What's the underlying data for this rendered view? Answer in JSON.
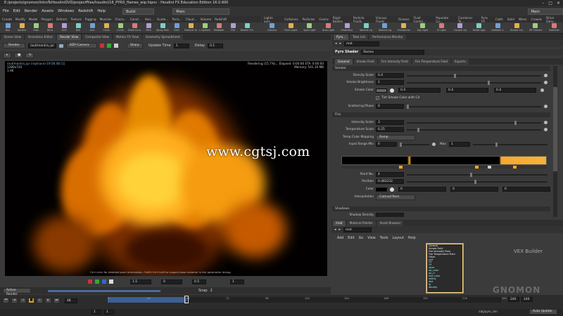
{
  "window": {
    "title": "E:/projects/gnomon/IntroToHoudiniDVD/projectFiles/houdini/16_PYRO_flames_wip.hipnc - Houdini FX Education Edition 16.0.600",
    "controls": [
      "–",
      "□",
      "✕"
    ]
  },
  "menu": {
    "items": [
      "File",
      "Edit",
      "Render",
      "Assets",
      "Windows",
      "Redshift",
      "Help"
    ],
    "desk_left": "Build",
    "desk_mid": "Main",
    "desk_right": "Main"
  },
  "shelf_tabs_left": [
    "Create",
    "Modify",
    "Model",
    "Polygon",
    "Deform",
    "Texture",
    "Rigging",
    "Muscles",
    "Chara...",
    "Const...",
    "Hair...",
    "Guide...",
    "Terra...",
    "Cloud...",
    "Volume",
    "Redshift"
  ],
  "shelf_tabs_right": [
    "Lights and...",
    "Collisions",
    "Particles",
    "Grains",
    "Rigid Bodies",
    "Particle Fluids",
    "Viscous Fluids",
    "Oceans",
    "Fluid Contai...",
    "Populate Co...",
    "Container To...",
    "Pyro FX",
    "Cloth",
    "Solid",
    "Wires",
    "Crowds",
    "Drive Simu..."
  ],
  "shelf_tools_left": [
    "Box",
    "Sphere",
    "Tube",
    "Torus",
    "Grid",
    "Null",
    "Line",
    "Circle",
    "Curve",
    "Draw Curve",
    "Path",
    "Spray Paint",
    "Font",
    "Platonic Solids",
    "L-System",
    "Metaball",
    "File",
    "Bleach Frame"
  ],
  "shelf_tools_right": [
    "Camera",
    "Point Light",
    "Spot Light",
    "Area Light",
    "Geometry Light",
    "Volume Light",
    "Distant Light",
    "Environment Light",
    "Sky Light",
    "GI Light",
    "Caustic Light",
    "Portal Light",
    "Ambient Light",
    "Stereo Camera",
    "VR Camera",
    "Switcher"
  ],
  "left_pane": {
    "tabs": [
      "Scene View",
      "Animation Editor",
      "Render View",
      "Composite View",
      "Motion FX View",
      "Geometry Spreadsheet"
    ],
    "render_button": "Render",
    "rop_path": "/out/mantra_ipr",
    "camera": "KDP Camera",
    "update_time_label": "Update Time",
    "update_time": "1",
    "delay_label": "Delay",
    "delay": "0.1",
    "snapshot_label": "Sharp",
    "rendering_status": "Rendering (15.7%)...  Elapsed: 0:00:06   ETA: 0:00:00",
    "memory": "Memory:     541.16 MB",
    "image_info_1": "/out/mantra_ipr (raytrace)-19:56:48 [1]",
    "image_info_2": "1280x720",
    "image_info_3": "1:46",
    "hint": "Ctrl+click for detailed pixel information. Shift+Ctrl+Left to inspect base material in the parameter dialog.",
    "bottom_fields": [
      "1.5",
      "0",
      "0.5",
      "1"
    ],
    "active_render": "Active Render",
    "snap_label": "Snap",
    "snap_value": "2"
  },
  "watermark": "www.cgtsj.com",
  "right_pane": {
    "tabs": [
      "Pyro...",
      "Take List",
      "Performance Monitor"
    ],
    "path": "mat",
    "shader_type": "Pyro Shader",
    "shader_name": "flames",
    "param_tabs": [
      "General",
      "Smoke Field",
      "Fire Intensity Field",
      "Fire Temperature Field",
      "Exports"
    ],
    "section_smoke": "Smoke",
    "density_scale_label": "Density Scale",
    "density_scale": "0.4",
    "smoke_brightness_label": "Smoke Brightness",
    "smoke_brightness": "1",
    "smoke_color_label": "Smoke Color",
    "smoke_color": [
      "0.4",
      "0.4",
      "0.4"
    ],
    "tint_label": "Tint Smoke Color with Cd",
    "scattering_phase_label": "Scattering Phase",
    "scattering_phase": "0",
    "section_fire": "Fire",
    "intensity_scale_label": "Intensity Scale",
    "intensity_scale": "3",
    "temperature_scale_label": "Temperature Scale",
    "temperature_scale": "0.25",
    "temp_mapping_label": "Temp Color Mapping",
    "temp_mapping": "Ramp",
    "input_range_label": "Input Range Min",
    "input_range_min": "0",
    "max_label": "Max",
    "input_range_max": "1",
    "point_no_label": "Point No.",
    "point_no": "4",
    "position_label": "Position",
    "position": "0.483232",
    "color_label": "Color",
    "color_values": [
      "0",
      "0",
      "0"
    ],
    "interpolation_label": "Interpolation",
    "interpolation": "Catmull-Rom",
    "section_shadows": "Shadows",
    "shadow_density_label": "Shadow Density"
  },
  "network_pane": {
    "tabs": [
      "/mat",
      "Material Palette",
      "Asset Browser"
    ],
    "path": "mat",
    "menu": [
      "Add",
      "Edit",
      "Go",
      "View",
      "Tools",
      "Layout",
      "Help"
    ],
    "builder_label": "VEX Builder",
    "node_rows": [
      "General",
      "Smoke Field",
      "Fire Intensity Field",
      "Fire Temperature Field",
      "Other",
      "surf",
      "Ce",
      "Of",
      "layer",
      "op_color",
      "op_ci",
      "inst_color",
      "intens",
      "dist",
      "lg",
      "density"
    ]
  },
  "timeline": {
    "current_frame": "48",
    "start": "1",
    "end": "240",
    "ticks": [
      "1",
      "24",
      "48",
      "72",
      "96",
      "120",
      "144",
      "168",
      "192",
      "216",
      "240"
    ],
    "auto_update": "Auto Update",
    "file_path": "/obj/pyro_sim"
  },
  "branding": "GNOMON",
  "colors": {
    "accent_blue": "#3d5f92",
    "ramp_orange": "#f5a623",
    "fire_core": "#ffd23a",
    "fire_edge": "#c55a00"
  }
}
